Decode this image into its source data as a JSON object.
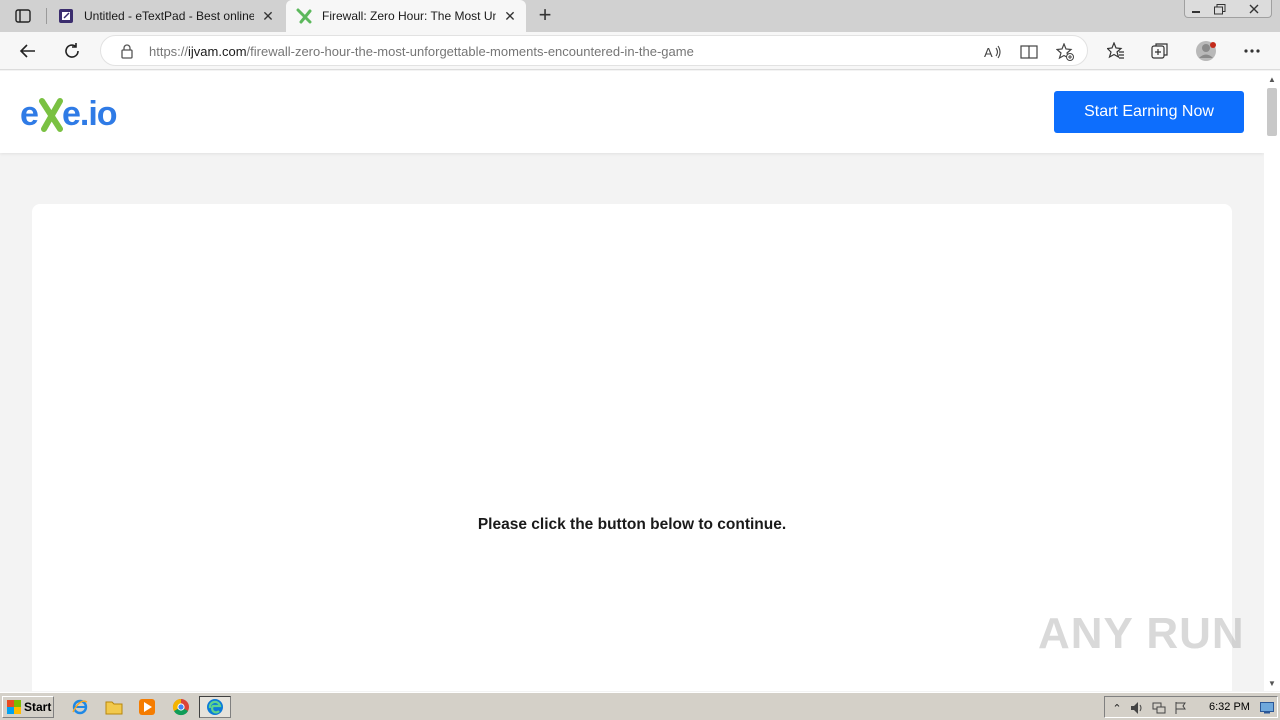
{
  "browser": {
    "tabs": [
      {
        "title": "Untitled - eTextPad - Best online N",
        "favicon": "etextpad-icon",
        "active": false
      },
      {
        "title": "Firewall: Zero Hour: The Most Un",
        "favicon": "exe-io-icon",
        "active": true
      }
    ],
    "url_scheme": "https://",
    "url_host": "ijvam.com",
    "url_path": "/firewall-zero-hour-the-most-unforgettable-moments-encountered-in-the-game"
  },
  "site": {
    "logo_text": "exe.io",
    "cta_label": "Start Earning Now",
    "continue_message": "Please click the button below to continue.",
    "brand_color": "#0d6efd",
    "watermark": "ANY RUN"
  },
  "taskbar": {
    "start_label": "Start",
    "clock": "6:32 PM"
  }
}
